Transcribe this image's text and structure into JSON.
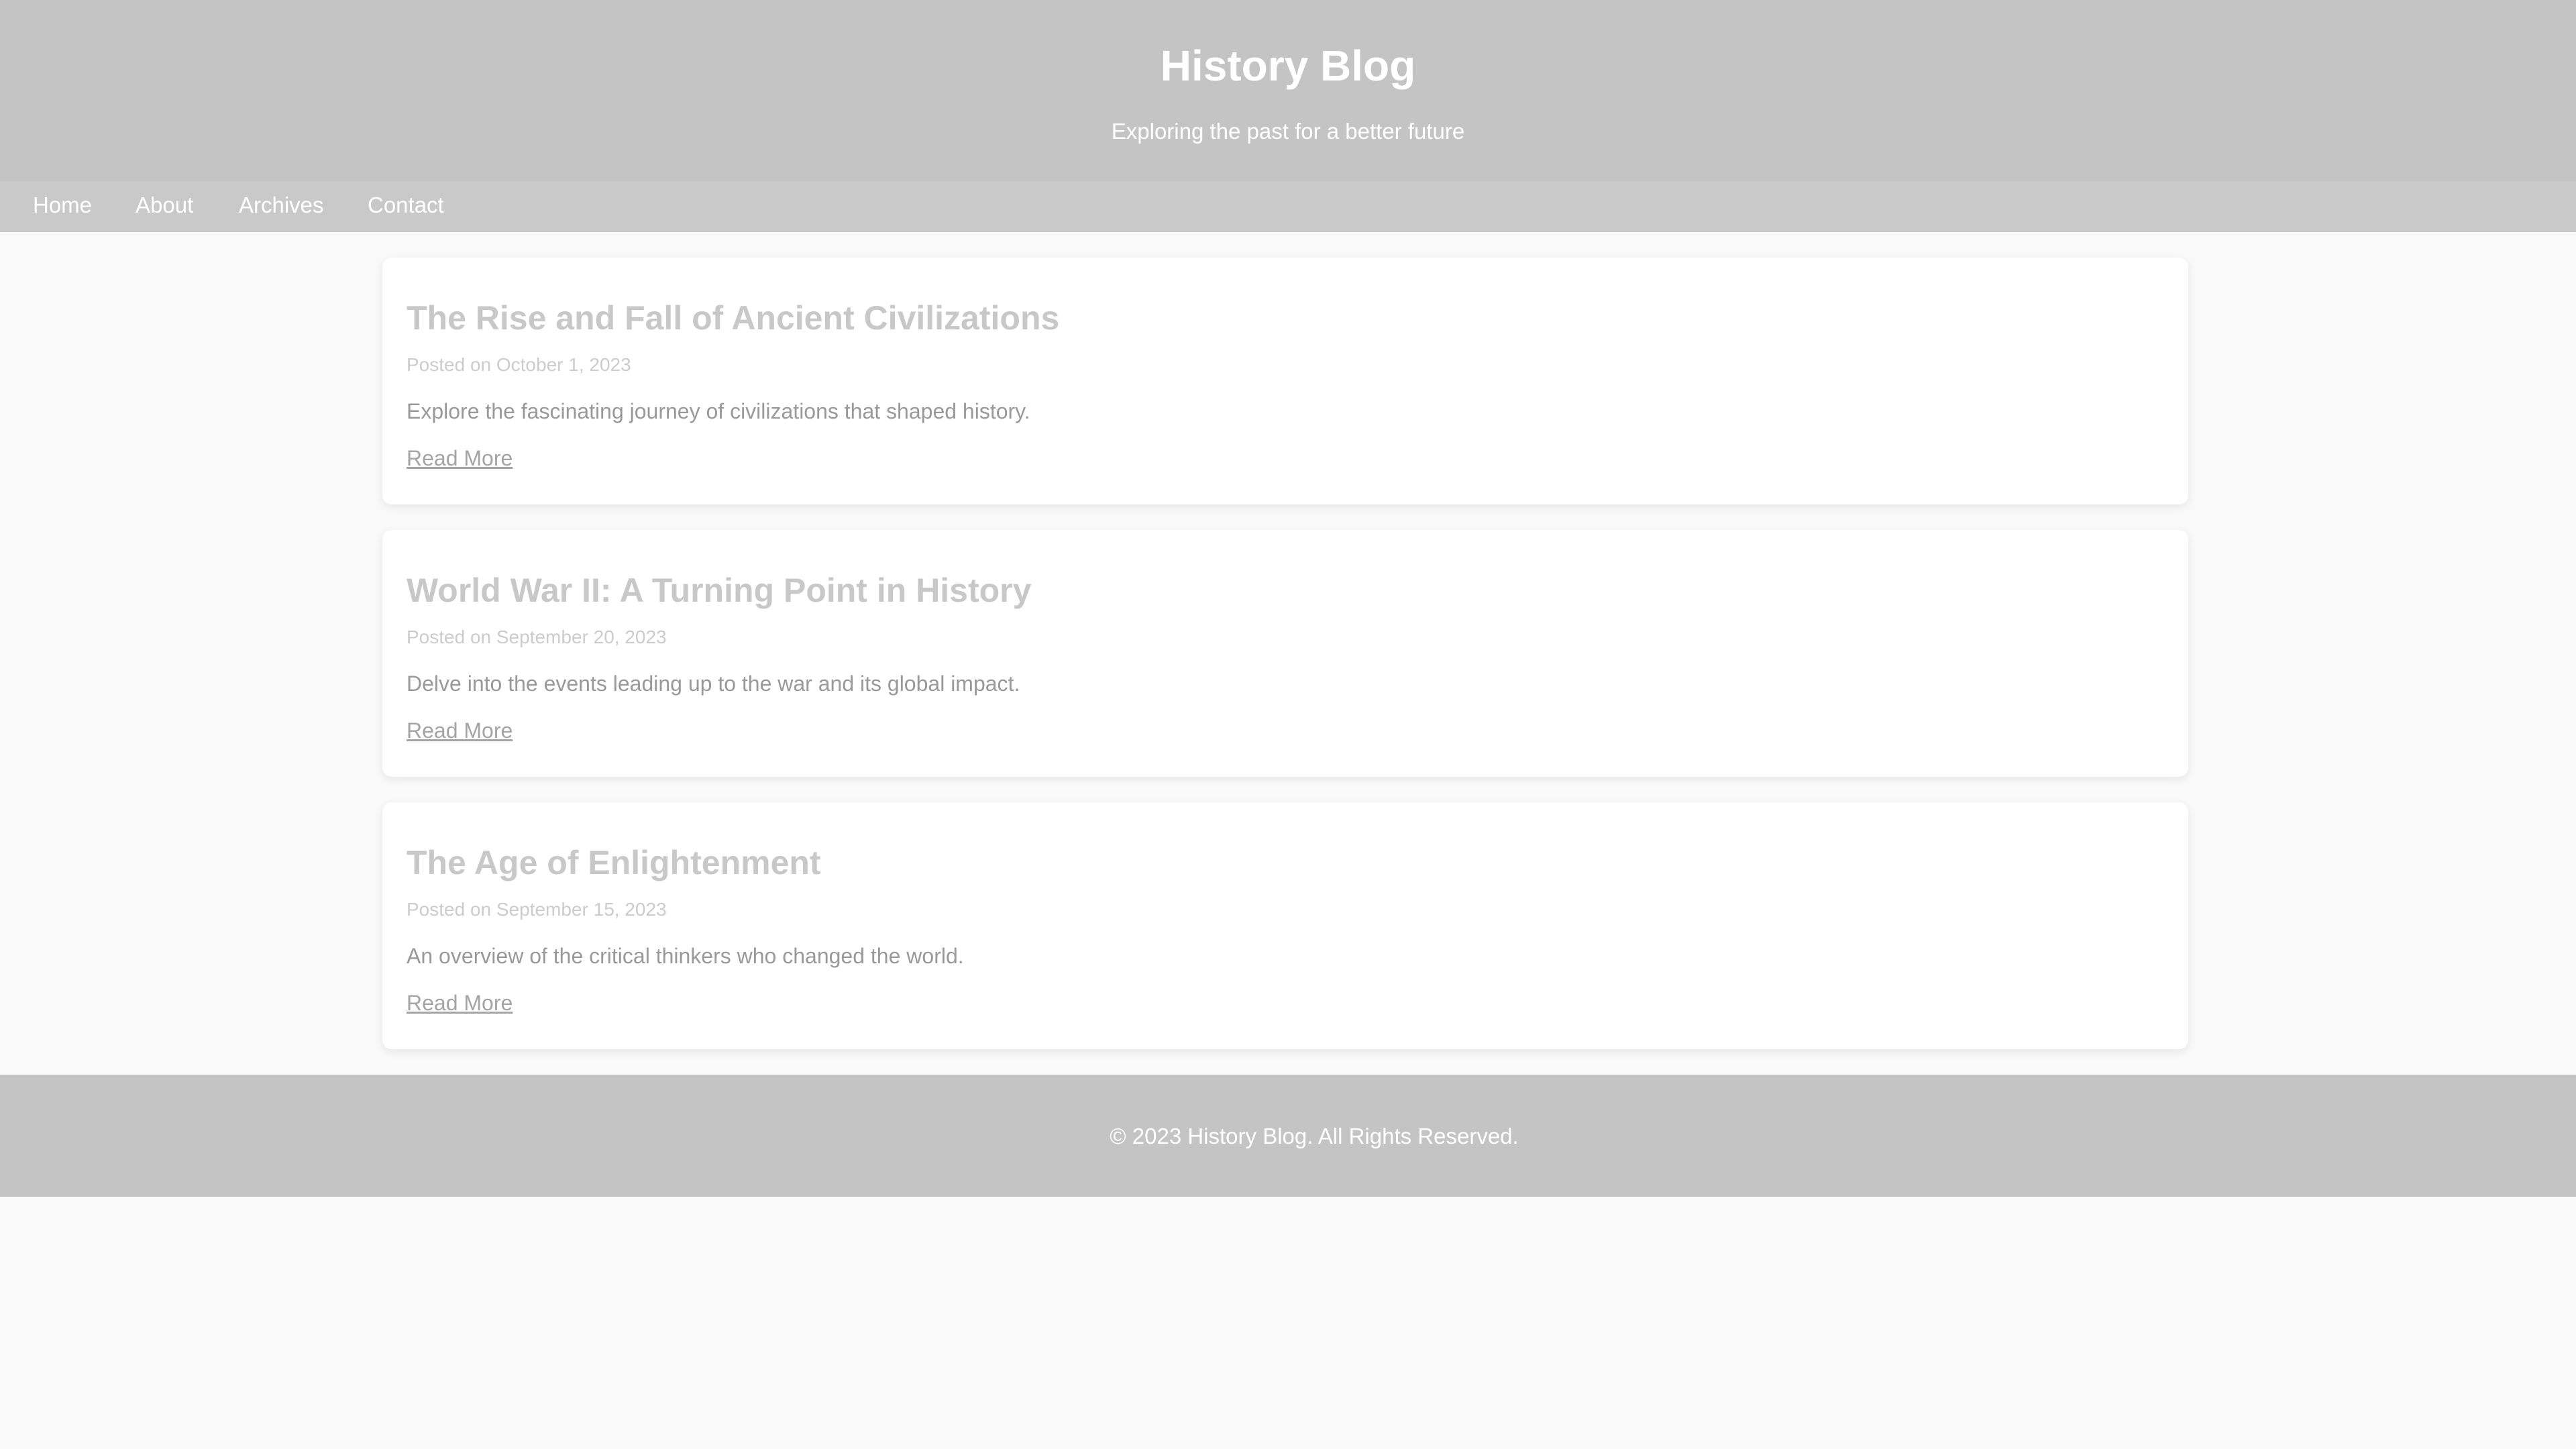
{
  "header": {
    "title": "History Blog",
    "tagline": "Exploring the past for a better future"
  },
  "nav": {
    "items": [
      {
        "label": "Home"
      },
      {
        "label": "About"
      },
      {
        "label": "Archives"
      },
      {
        "label": "Contact"
      }
    ]
  },
  "posts": [
    {
      "title": "The Rise and Fall of Ancient Civilizations",
      "meta": "Posted on October 1, 2023",
      "excerpt": "Explore the fascinating journey of civilizations that shaped history.",
      "link_label": "Read More"
    },
    {
      "title": "World War II: A Turning Point in History",
      "meta": "Posted on September 20, 2023",
      "excerpt": "Delve into the events leading up to the war and its global impact.",
      "link_label": "Read More"
    },
    {
      "title": "The Age of Enlightenment",
      "meta": "Posted on September 15, 2023",
      "excerpt": "An overview of the critical thinkers who changed the world.",
      "link_label": "Read More"
    }
  ],
  "footer": {
    "text": "© 2023 History Blog. All Rights Reserved."
  },
  "colors": {
    "header_bg": "#c4c4c4",
    "nav_bg": "#c9c9c9",
    "page_bg": "#f9f9f9",
    "card_bg": "#ffffff",
    "header_text": "#ffffff"
  }
}
